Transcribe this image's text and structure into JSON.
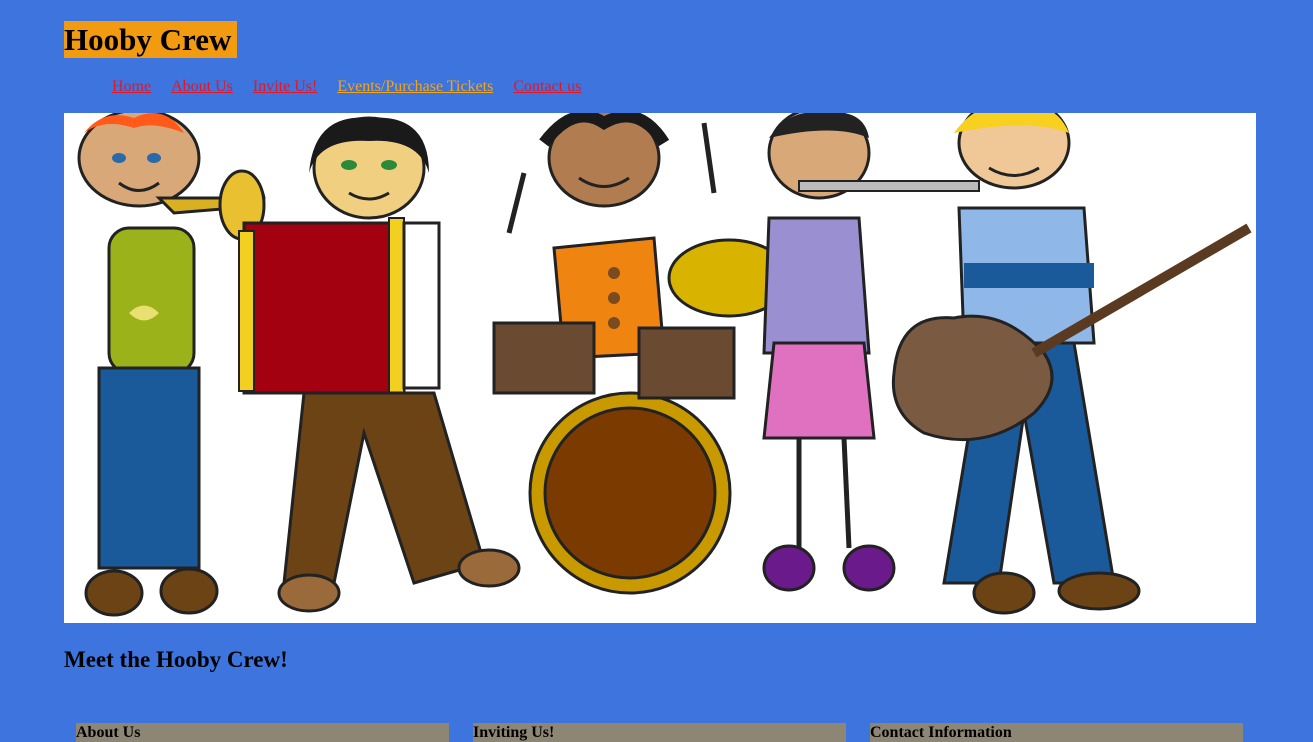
{
  "site": {
    "title": "Hooby Crew"
  },
  "nav": {
    "items": [
      {
        "label": "Home"
      },
      {
        "label": "About Us"
      },
      {
        "label": "Invite Us!"
      },
      {
        "label": "Events/Purchase Tickets"
      },
      {
        "label": "Contact us"
      }
    ]
  },
  "hero": {
    "subject": "cartoon band illustration",
    "colors": {
      "trumpet_shirt": "#9cb21a",
      "accordion_red": "#a30010",
      "drummer_shirt": "#f08410",
      "flute_shirt": "#9a8fd0",
      "guitar_shirt": "#8fb8e8",
      "pants_blue": "#1a5a9a",
      "pants_brown": "#6b4315"
    }
  },
  "main": {
    "heading": "Meet the Hooby Crew!"
  },
  "footer": {
    "sections": [
      {
        "title": "About Us"
      },
      {
        "title": "Inviting Us!"
      },
      {
        "title": "Contact Information"
      }
    ]
  },
  "theme": {
    "background": "#3d74dd",
    "title_bg": "#f39b10",
    "link": "#e0182a",
    "active_link": "#f2a51a",
    "footer_box": "#8e8675"
  }
}
